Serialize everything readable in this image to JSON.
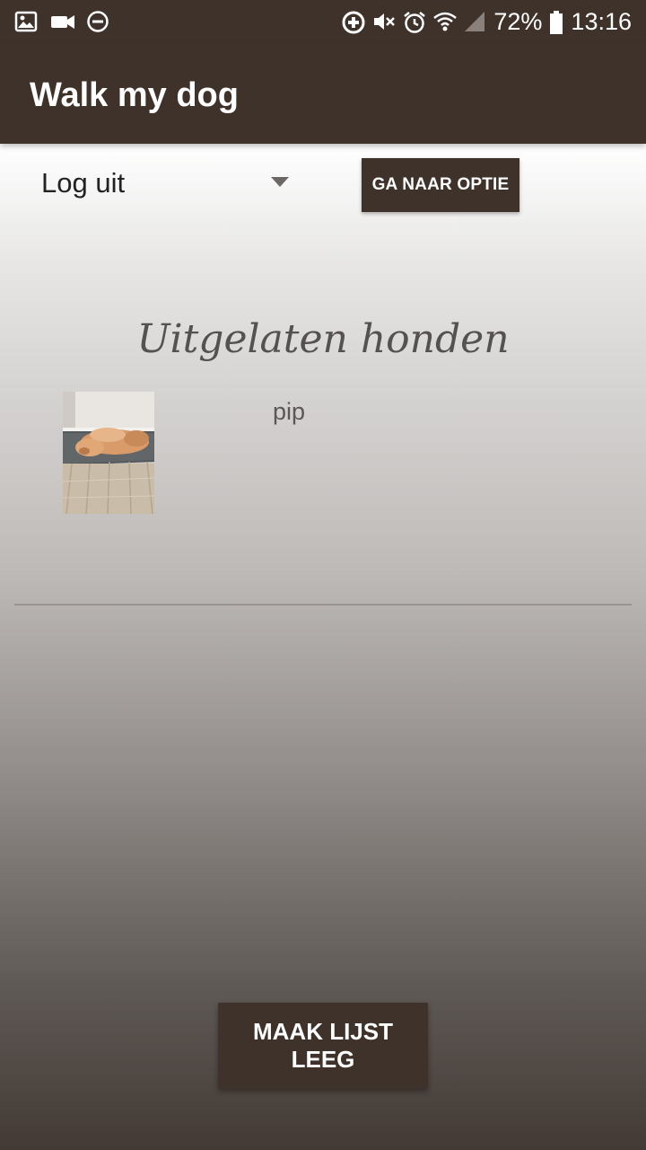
{
  "status_bar": {
    "icons_left": [
      "image-icon",
      "video-camera-icon",
      "do-not-disturb-icon"
    ],
    "icons_right": [
      "data-saver-icon",
      "mute-icon",
      "alarm-icon",
      "wifi-icon",
      "signal-icon"
    ],
    "battery_percent": "72%",
    "time": "13:16"
  },
  "app_bar": {
    "title": "Walk my dog"
  },
  "controls": {
    "dropdown_selected": "Log uit",
    "option_button_label": "GA NAAR OPTIE"
  },
  "main": {
    "heading": "Uitgelaten honden",
    "dogs": [
      {
        "name": "pip",
        "photo": "dog-photo"
      }
    ]
  },
  "footer": {
    "clear_button_label": "MAAK LIJST LEEG"
  },
  "colors": {
    "primary": "#3f322a",
    "text_dark": "#222222",
    "text_muted": "#5a5755"
  }
}
